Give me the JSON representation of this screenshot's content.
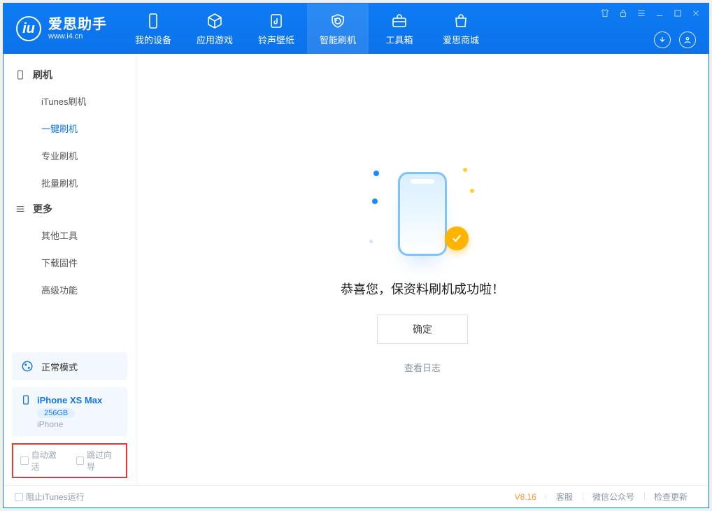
{
  "brand": {
    "name": "爱思助手",
    "url": "www.i4.cn"
  },
  "nav": {
    "items": [
      {
        "label": "我的设备"
      },
      {
        "label": "应用游戏"
      },
      {
        "label": "铃声壁纸"
      },
      {
        "label": "智能刷机"
      },
      {
        "label": "工具箱"
      },
      {
        "label": "爱思商城"
      }
    ]
  },
  "sidebar": {
    "sections": [
      {
        "title": "刷机",
        "items": [
          "iTunes刷机",
          "一键刷机",
          "专业刷机",
          "批量刷机"
        ]
      },
      {
        "title": "更多",
        "items": [
          "其他工具",
          "下载固件",
          "高级功能"
        ]
      }
    ],
    "mode_card": "正常模式",
    "device": {
      "name": "iPhone XS Max",
      "storage": "256GB",
      "type": "iPhone"
    },
    "checkbox1": "自动激活",
    "checkbox2": "跳过向导"
  },
  "main": {
    "success_text": "恭喜您，保资料刷机成功啦！",
    "ok_button": "确定",
    "log_link": "查看日志"
  },
  "status": {
    "block_itunes": "阻止iTunes运行",
    "version": "V8.16",
    "links": [
      "客服",
      "微信公众号",
      "检查更新"
    ]
  }
}
